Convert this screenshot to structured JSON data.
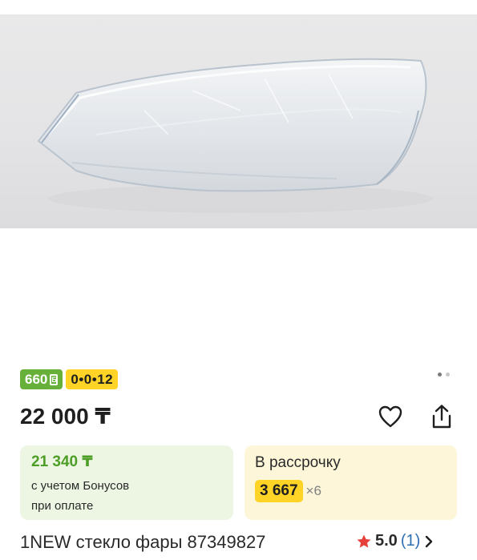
{
  "gallery": {
    "image_alt": "1NEW стекло фары 87349827",
    "dots": [
      true,
      false
    ]
  },
  "badges": {
    "bonus_value": "660",
    "bonus_mark": "Б",
    "installment_plan": "0•0•12"
  },
  "price": {
    "main": "22 000 ₸"
  },
  "actions": {
    "favorite_icon": "heart-icon",
    "share_icon": "share-icon"
  },
  "bonus_card": {
    "amount": "21 340 ₸",
    "line1": "с учетом Бонусов",
    "line2": "при оплате"
  },
  "installment_card": {
    "title": "В рассрочку",
    "monthly": "3 667",
    "months": "×6"
  },
  "product": {
    "title": "1NEW стекло фары 87349827",
    "rating": "5.0",
    "reviews": "(1)"
  },
  "colors": {
    "bonus_green": "#67b03a",
    "installment_yellow": "#ffd426",
    "star_red": "#e5413a",
    "link_blue": "#2f6fb3"
  }
}
